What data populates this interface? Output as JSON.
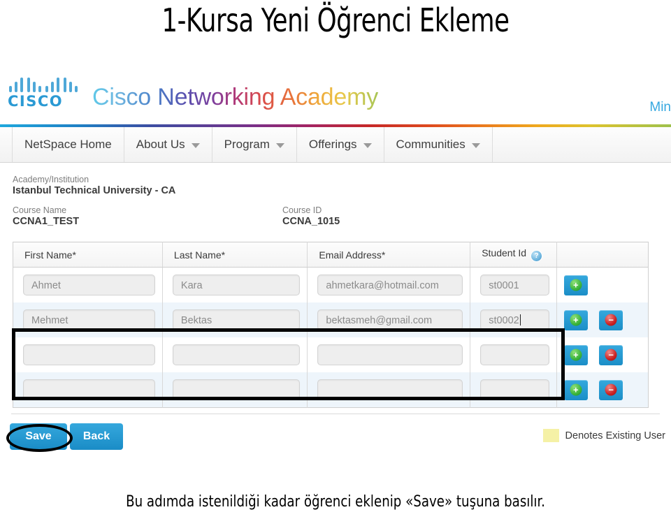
{
  "slide": {
    "title": "1-Kursa Yeni Öğrenci Ekleme",
    "caption": "Bu adımda istenildiği kadar öğrenci eklenip «Save» tuşuna basılır."
  },
  "brand": {
    "logo_wordmark": "CISCO",
    "title": "Cisco Networking Academy",
    "user_link": "Min",
    "logo_color": "#2b9ad4",
    "link_color": "#36a8e0"
  },
  "nav": {
    "items": [
      {
        "label": "NetSpace Home",
        "has_chevron": false
      },
      {
        "label": "About Us",
        "has_chevron": true
      },
      {
        "label": "Program",
        "has_chevron": true
      },
      {
        "label": "Offerings",
        "has_chevron": true
      },
      {
        "label": "Communities",
        "has_chevron": true
      }
    ]
  },
  "course_info": {
    "academy_label": "Academy/Institution",
    "academy_value": "Istanbul Technical University - CA",
    "course_name_label": "Course Name",
    "course_name_value": "CCNA1_TEST",
    "course_id_label": "Course ID",
    "course_id_value": "CCNA_1015"
  },
  "table": {
    "columns": [
      "First Name*",
      "Last Name*",
      "Email Address*",
      "Student Id"
    ],
    "student_id_help_glyph": "?",
    "rows": [
      {
        "first_name": "Ahmet",
        "last_name": "Kara",
        "email": "ahmetkara@hotmail.com",
        "student_id": "st0001",
        "shaded": false,
        "has_add": true,
        "has_remove": false,
        "caret": false
      },
      {
        "first_name": "Mehmet",
        "last_name": "Bektas",
        "email": "bektasmeh@gmail.com",
        "student_id": "st0002",
        "shaded": true,
        "has_add": true,
        "has_remove": true,
        "caret": true
      },
      {
        "first_name": "",
        "last_name": "",
        "email": "",
        "student_id": "",
        "shaded": false,
        "has_add": true,
        "has_remove": true,
        "caret": false
      },
      {
        "first_name": "",
        "last_name": "",
        "email": "",
        "student_id": "",
        "shaded": true,
        "has_add": true,
        "has_remove": true,
        "caret": false
      }
    ]
  },
  "footer": {
    "save_label": "Save",
    "back_label": "Back",
    "legend_text": "Denotes Existing User",
    "legend_color": "#f5f1a6",
    "button_color": "#2196d4"
  }
}
